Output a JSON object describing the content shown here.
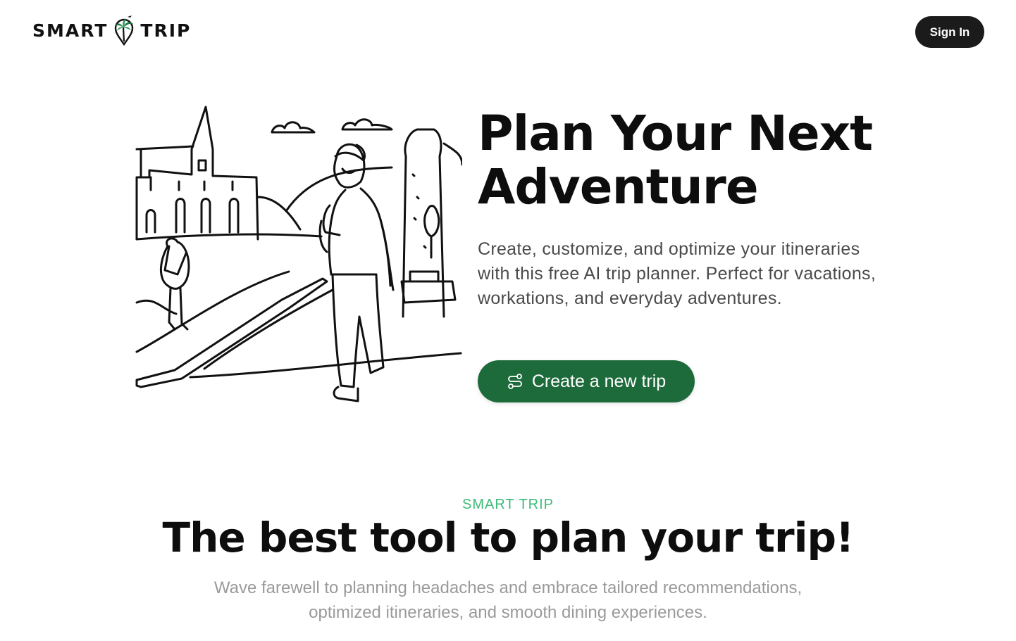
{
  "brand": {
    "name_left": "SMART",
    "name_right": "TRIP",
    "logo_icon": "palm-tree-pin-icon",
    "accent_color": "#1d6a3a",
    "eyebrow_color": "#3dbb7a"
  },
  "header": {
    "signin_label": "Sign In"
  },
  "hero": {
    "title_line1": "Plan Your Next",
    "title_line2": "Adventure",
    "description": "Create, customize, and optimize your itineraries with this free AI trip planner. Perfect for vacations, workations, and everyday adventures.",
    "cta_label": "Create a new trip",
    "cta_icon": "route-icon",
    "illustration": "travel-sketch-illustration"
  },
  "features": {
    "eyebrow": "SMART TRIP",
    "title": "The best tool to plan your trip!",
    "description": "Wave farewell to planning headaches and embrace tailored recommendations, optimized itineraries, and smooth dining experiences."
  }
}
